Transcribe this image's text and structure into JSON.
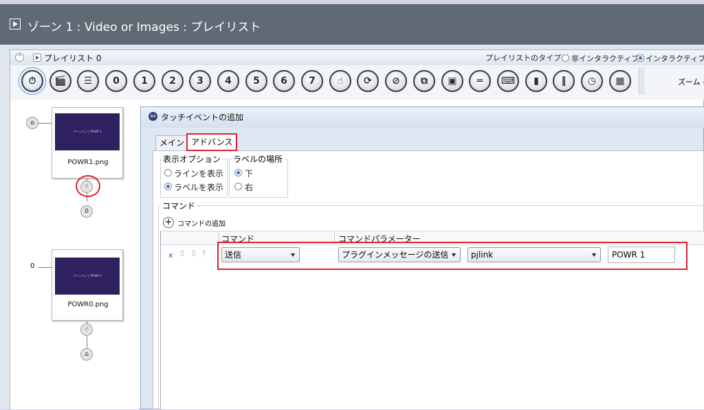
{
  "window": {
    "title": "ゾーン 1 : Video or Images : プレイリスト"
  },
  "playlist": {
    "label": "プレイリスト 0",
    "type_label": "プレイリストのタイプ :",
    "type_options": [
      "非インタラクティブ",
      "インタラクティブ"
    ],
    "selected_type": "インタラクティブ",
    "zoom_label": "ズーム -"
  },
  "toolbar": {
    "tools": [
      {
        "icon": "stopwatch-icon",
        "glyph": "⏱"
      },
      {
        "icon": "clapperboard-icon",
        "glyph": "🎬"
      },
      {
        "icon": "checklist-icon",
        "glyph": "☰"
      },
      {
        "icon": "key-0-icon",
        "glyph": "0"
      },
      {
        "icon": "key-1-icon",
        "glyph": "1"
      },
      {
        "icon": "key-2-icon",
        "glyph": "2"
      },
      {
        "icon": "key-3-icon",
        "glyph": "3"
      },
      {
        "icon": "key-4-icon",
        "glyph": "4"
      },
      {
        "icon": "key-5-icon",
        "glyph": "5"
      },
      {
        "icon": "key-6-icon",
        "glyph": "6"
      },
      {
        "icon": "key-7-icon",
        "glyph": "7"
      },
      {
        "icon": "touch-icon",
        "glyph": "☝"
      },
      {
        "icon": "refresh-icon",
        "glyph": "⟳"
      },
      {
        "icon": "no-signal-icon",
        "glyph": "⊘"
      },
      {
        "icon": "window-overlap-icon",
        "glyph": "⧉"
      },
      {
        "icon": "monitor-icon",
        "glyph": "▣"
      },
      {
        "icon": "serial-cable-icon",
        "glyph": "═"
      },
      {
        "icon": "keyboard-icon",
        "glyph": "⌨"
      },
      {
        "icon": "remote-icon",
        "glyph": "▮"
      },
      {
        "icon": "barcode-icon",
        "glyph": "‖"
      },
      {
        "icon": "timed-screen-icon",
        "glyph": "◷"
      },
      {
        "icon": "calendar-clock-icon",
        "glyph": "▦"
      }
    ]
  },
  "flow": {
    "nodes": [
      {
        "filename": "POWR1.png",
        "thumb_text": "クリックして POWR 1",
        "count": "0"
      },
      {
        "filename": "POWR0.png",
        "thumb_text": "クリックして POWR 0",
        "count": "0"
      }
    ]
  },
  "dialog": {
    "title": "タッチイベントの追加",
    "tabs": [
      "メイン",
      "アドバンス"
    ],
    "active_tab": "アドバンス",
    "display_options": {
      "label": "表示オプション",
      "options": [
        "ラインを表示",
        "ラベルを表示"
      ],
      "selected": "ラベルを表示"
    },
    "label_position": {
      "label": "ラベルの場所",
      "options": [
        "下",
        "右"
      ],
      "selected": "下"
    },
    "commands": {
      "group_label": "コマンド",
      "add_label": "コマンドの追加",
      "columns": [
        "コマンド",
        "コマンドパラメーター"
      ],
      "rows": [
        {
          "delete": "x",
          "command": "送信",
          "param_type": "プラグインメッセージの送信",
          "plugin": "pjlink",
          "value": "POWR 1"
        }
      ]
    }
  },
  "colors": {
    "highlight": "#e0202a",
    "titlebar": "#5f6a74",
    "thumbnail": "#2f2060"
  }
}
